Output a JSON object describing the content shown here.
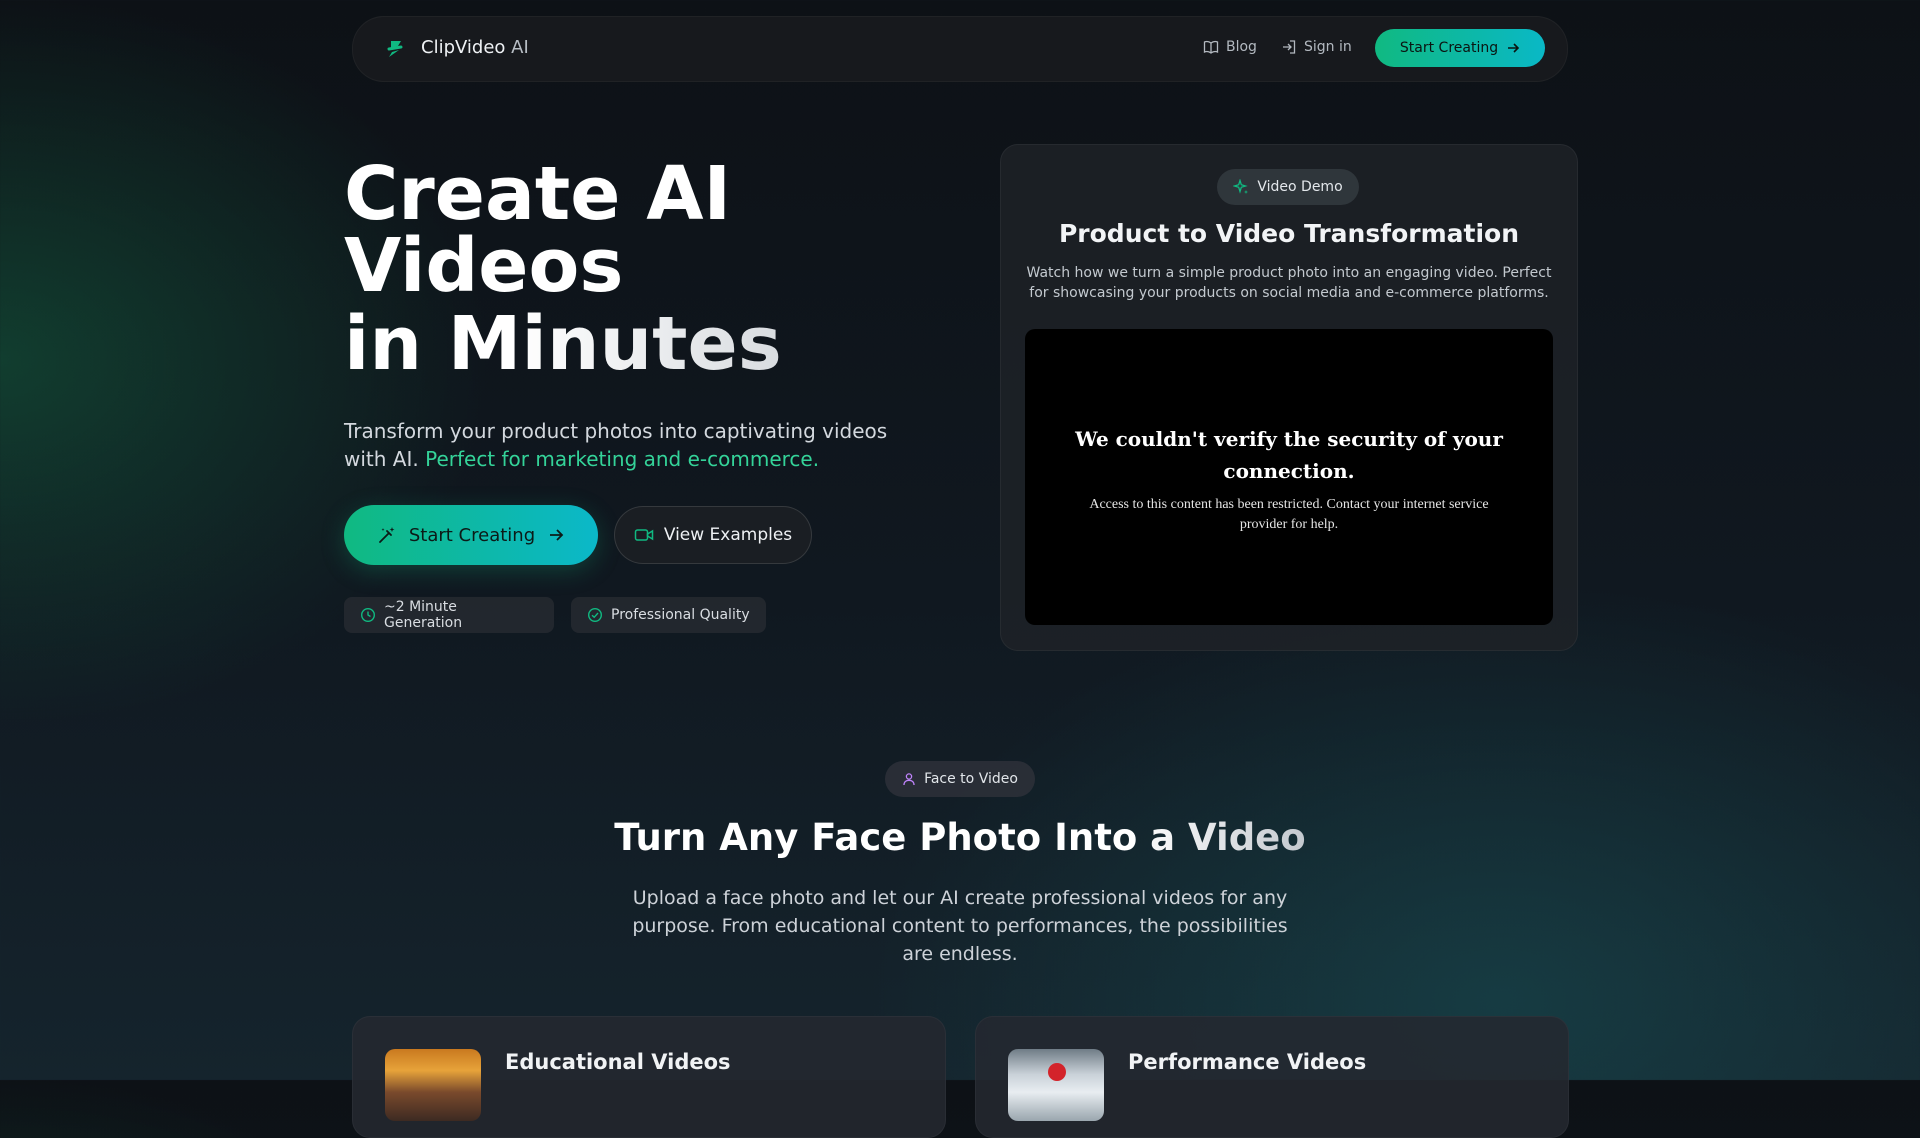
{
  "nav": {
    "brand": "ClipVideo",
    "brand_suffix": "AI",
    "blog": "Blog",
    "sign_in": "Sign in",
    "cta": "Start Creating"
  },
  "hero": {
    "title_line1": "Create AI",
    "title_line2": "Videos",
    "title_line3": "in Minutes",
    "subtitle": "Transform your product photos into captivating videos with AI.",
    "subtitle_highlight": "Perfect for marketing and e-commerce.",
    "primary_button": "Start Creating",
    "secondary_button": "View Examples",
    "pill_time": "~2 Minute Generation",
    "pill_quality": "Professional Quality"
  },
  "demo": {
    "badge": "Video Demo",
    "title": "Product to Video Transformation",
    "description": "Watch how we turn a simple product photo into an engaging video. Perfect for showcasing your products on social media and e-commerce platforms.",
    "error_title": "We couldn't verify the security of your connection.",
    "error_text": "Access to this content has been restricted. Contact your internet service provider for help."
  },
  "face": {
    "badge": "Face to Video",
    "title": "Turn Any Face Photo Into a Video",
    "description": "Upload a face photo and let our AI create professional videos for any purpose. From educational content to performances, the possibilities are endless.",
    "cards": [
      {
        "title": "Educational Videos"
      },
      {
        "title": "Performance Videos"
      }
    ]
  },
  "colors": {
    "accent": "#10b981",
    "accent_end": "#0ab8c6",
    "highlight_text": "#34d399",
    "face_icon": "#c084fc"
  },
  "icons": [
    "logo-icon",
    "book-icon",
    "sign-in-icon",
    "arrow-right-icon",
    "magic-wand-icon",
    "video-camera-icon",
    "clock-icon",
    "check-circle-icon",
    "sparkles-icon",
    "user-icon"
  ]
}
